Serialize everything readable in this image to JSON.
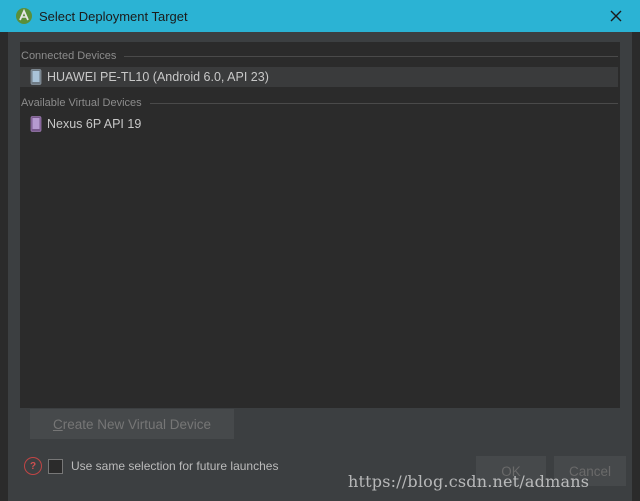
{
  "window": {
    "title": "Select Deployment Target"
  },
  "connected": {
    "header": "Connected Devices",
    "devices": [
      {
        "label": "HUAWEI PE-TL10 (Android 6.0, API 23)",
        "icon": "physical-phone-icon",
        "selected": true
      }
    ]
  },
  "virtual": {
    "header": "Available Virtual Devices",
    "devices": [
      {
        "label": "Nexus 6P API 19",
        "icon": "virtual-device-icon",
        "selected": false
      }
    ]
  },
  "actions": {
    "create_mnemonic": "C",
    "create_rest": "reate New Virtual Device",
    "ok_label": "OK",
    "cancel_label": "Cancel"
  },
  "footer": {
    "checkbox_label": "Use same selection for future launches",
    "checkbox_checked": false
  },
  "watermark": "https://blog.csdn.net/admans",
  "colors": {
    "titlebar": "#2bb3d4",
    "dialog_bg": "#3c3f41",
    "list_bg": "#2b2b2b",
    "selection": "#3a3b3c",
    "help_red": "#c04545"
  }
}
